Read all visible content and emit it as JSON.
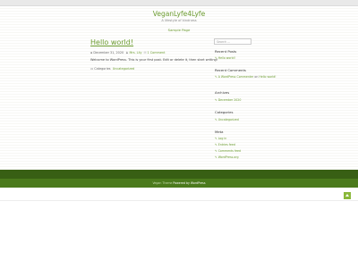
{
  "site": {
    "title": "VeganLyfe4Lyfe",
    "description": "A lifestyle of kindness",
    "menu_link": "Sample Page"
  },
  "post": {
    "title": "Hello world!",
    "date": "December 31, 2020",
    "author": "Mrs. Lily",
    "comments": "1 Comment",
    "body": "Welcome to WordPress. This is your first post. Edit or delete it, then start writing!",
    "categories_label": "Categories",
    "category": "Uncategorized"
  },
  "sidebar": {
    "search_placeholder": "Search ...",
    "recent_posts_heading": "Recent Posts",
    "recent_posts": [
      "Hello world!"
    ],
    "recent_comments_heading": "Recent Comments",
    "recent_comment_author": "A WordPress Commenter",
    "recent_comment_on": "on",
    "recent_comment_post": "Hello world!",
    "archives_heading": "Archives",
    "archives": [
      "December 2020"
    ],
    "categories_heading": "Categories",
    "categories": [
      "Uncategorized"
    ],
    "meta_heading": "Meta",
    "meta": [
      "Log in",
      "Entries feed",
      "Comments feed",
      "WordPress.org"
    ]
  },
  "footer": {
    "theme_text": "Vegan Theme",
    "powered_label": "Powered by WordPress"
  },
  "colors": {
    "accent": "#6b9b2f",
    "footer_dark": "#385f14",
    "footer_mid": "#4b7a1c"
  }
}
